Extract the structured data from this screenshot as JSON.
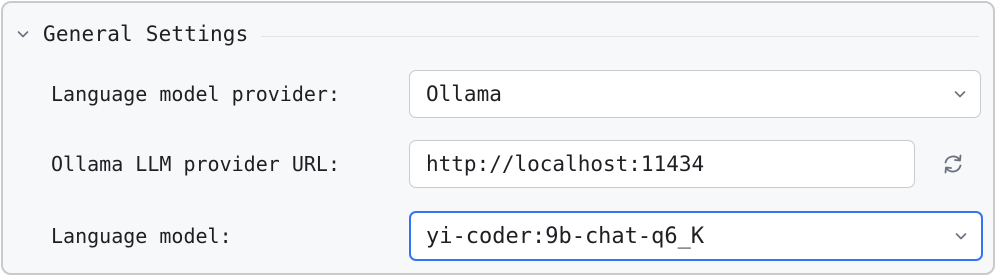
{
  "section": {
    "title": "General Settings",
    "expand_icon": "chevron-down-icon"
  },
  "provider": {
    "label": "Language model provider:",
    "value": "Ollama",
    "icon": "chevron-down-icon"
  },
  "url": {
    "label": "Ollama LLM provider URL:",
    "value": "http://localhost:11434",
    "refresh_icon": "refresh-icon"
  },
  "model": {
    "label": "Language model:",
    "value": "yi-coder:9b-chat-q6_K",
    "icon": "chevron-down-icon"
  },
  "colors": {
    "accent": "#3574f0",
    "border": "#c9cacd",
    "panel_bg": "#f7f8fa",
    "text": "#1e1f22"
  }
}
